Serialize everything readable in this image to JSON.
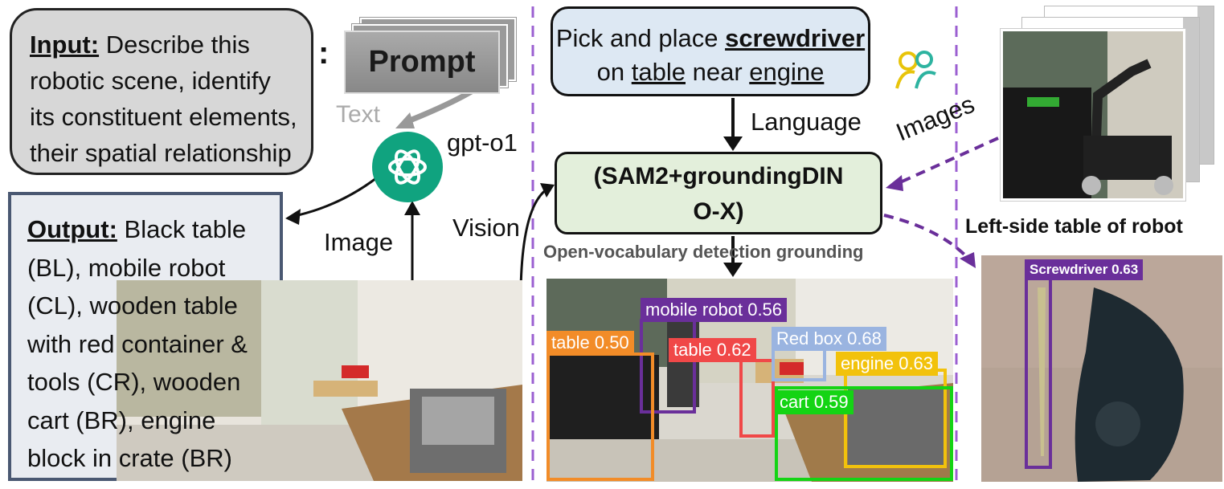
{
  "input": {
    "label": "Input:",
    "text": "Describe this robotic scene, identify its constituent elements, their spatial relationship"
  },
  "prompt": {
    "colon": ":",
    "label": "Prompt",
    "text_label": "Text"
  },
  "model_llm": {
    "name": "gpt-o1"
  },
  "output": {
    "label": "Output:",
    "text": "Black table (BL), mobile robot (CL), wooden table with red container & tools (CR), wooden cart (BR), engine block in crate (BR)"
  },
  "arrows": {
    "image_label": "Image",
    "vision_label": "Vision",
    "language_label": "Language",
    "images_label": "Images"
  },
  "task": {
    "line1_prefix": "Pick and place ",
    "object": "screwdriver",
    "line2_prefix": "on ",
    "target": "table",
    "line2_mid": " near ",
    "reference": "engine"
  },
  "detector": {
    "title": "(SAM2+groundingDINO-X)",
    "line1": "(SAM2+groundingDIN",
    "line2": "O-X)",
    "caption": "Open-vocabulary detection grounding"
  },
  "detections": [
    {
      "label": "mobile robot",
      "score": "0.56",
      "color": "#6a2f9a"
    },
    {
      "label": "table",
      "score": "0.50",
      "color": "#f28c28"
    },
    {
      "label": "table",
      "score": "0.62",
      "color": "#f04848"
    },
    {
      "label": "Red box",
      "score": "0.68",
      "color": "#9ab4e0"
    },
    {
      "label": "engine",
      "score": "0.63",
      "color": "#f2c20c"
    },
    {
      "label": "cart",
      "score": "0.59",
      "color": "#14d414"
    }
  ],
  "right_panel": {
    "caption": "Left-side table of robot",
    "detection": {
      "label": "Screwdriver",
      "score": "0.63",
      "color": "#6a2f9a"
    }
  },
  "colors": {
    "divider": "#9b5fd1",
    "dashed_arrow": "#6a2f9a",
    "gpt": "#10a37f"
  }
}
